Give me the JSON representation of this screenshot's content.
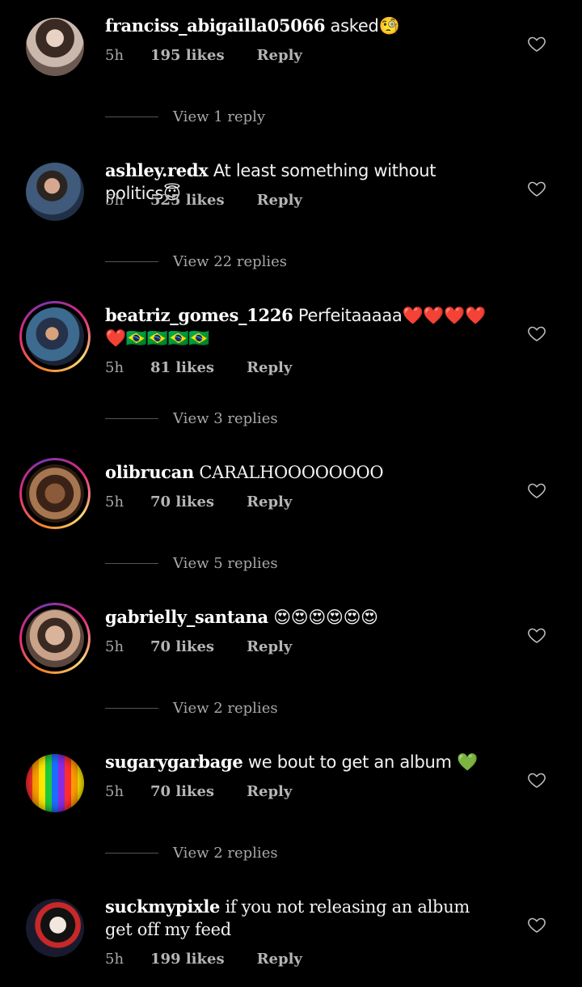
{
  "comments": [
    {
      "username": "franciss_abigailla05066",
      "text": "asked🧐",
      "time": "5h",
      "likes": "195 likes",
      "reply_label": "Reply",
      "view_replies": "View 1 reply",
      "has_story_ring": false
    },
    {
      "username": "ashley.redx",
      "text": "At least something without politics😇",
      "time": "5h",
      "likes": "525 likes",
      "reply_label": "Reply",
      "view_replies": "View 22 replies",
      "has_story_ring": false
    },
    {
      "username": "beatriz_gomes_1226",
      "text": "Perfeitaaaaa❤️❤️❤️❤️❤️🇧🇷🇧🇷🇧🇷🇧🇷",
      "time": "5h",
      "likes": "81 likes",
      "reply_label": "Reply",
      "view_replies": "View 3 replies",
      "has_story_ring": true
    },
    {
      "username": "olibrucan",
      "text": "CARALHOOOOOOOO",
      "time": "5h",
      "likes": "70 likes",
      "reply_label": "Reply",
      "view_replies": "View 5 replies",
      "has_story_ring": true
    },
    {
      "username": "gabrielly_santana",
      "text": "😍😍😍😍😍😍",
      "time": "5h",
      "likes": "70 likes",
      "reply_label": "Reply",
      "view_replies": "View 2 replies",
      "has_story_ring": true
    },
    {
      "username": "sugarygarbage",
      "text": "we bout to get an album 💚",
      "time": "5h",
      "likes": "70 likes",
      "reply_label": "Reply",
      "view_replies": "View 2 replies",
      "has_story_ring": false
    },
    {
      "username": "suckmypixle",
      "text": "if you not releasing an album get off my feed",
      "time": "5h",
      "likes": "199 likes",
      "reply_label": "Reply",
      "has_story_ring": false
    }
  ],
  "icons": {
    "like": "heart-outline-icon"
  },
  "colors": {
    "background": "#000000",
    "secondary_text": "#a8a8a8",
    "story_ring": [
      "#f58529",
      "#dd2a7b",
      "#8134af"
    ]
  }
}
